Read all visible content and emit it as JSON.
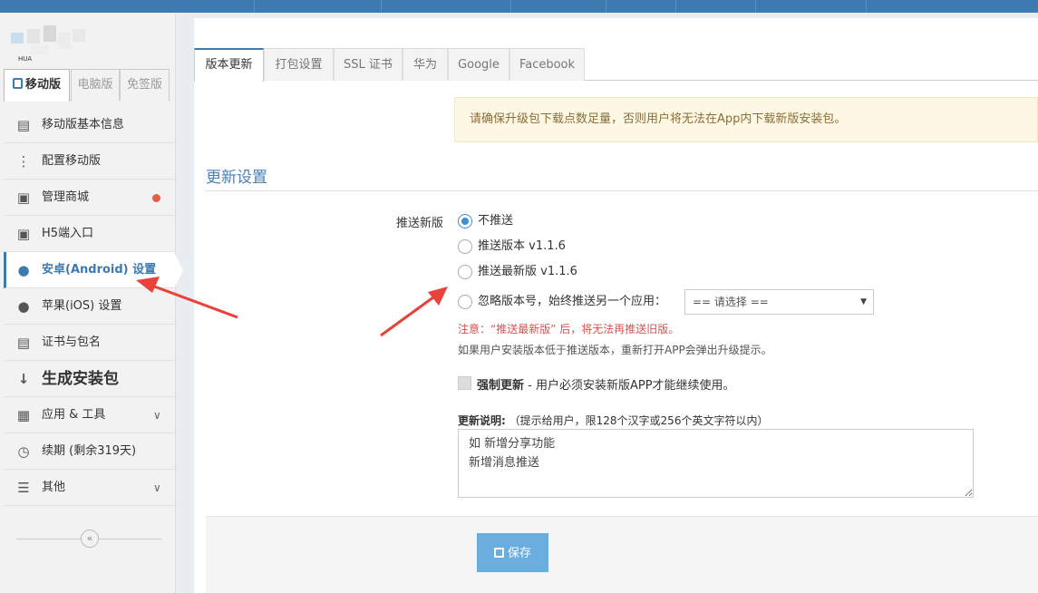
{
  "sidebar": {
    "logo_text": "HUA",
    "tabs": [
      {
        "label": "移动版",
        "active": true
      },
      {
        "label": "电脑版",
        "active": false
      },
      {
        "label": "免签版",
        "active": false
      }
    ],
    "items": [
      {
        "label": "移动版基本信息",
        "icon": "info-list-icon"
      },
      {
        "label": "配置移动版",
        "icon": "sliders-icon"
      },
      {
        "label": "管理商城",
        "icon": "shopping-bag-icon",
        "badge": true
      },
      {
        "label": "H5端入口",
        "icon": "shopping-bag-icon"
      },
      {
        "label": "安卓(Android) 设置",
        "icon": "android-icon",
        "active": true
      },
      {
        "label": "苹果(iOS) 设置",
        "icon": "apple-icon"
      },
      {
        "label": "证书与包名",
        "icon": "certificate-icon"
      },
      {
        "label": "生成安装包",
        "icon": "sort-numeric-icon"
      },
      {
        "label": "应用 & 工具",
        "icon": "grid-icon",
        "expandable": true
      },
      {
        "label": "续期 (剩余319天)",
        "icon": "clock-icon"
      },
      {
        "label": "其他",
        "icon": "menu-icon",
        "expandable": true
      }
    ],
    "collapse_icon": "double-chevron-left-icon"
  },
  "main": {
    "tabs": [
      {
        "label": "版本更新",
        "active": true
      },
      {
        "label": "打包设置"
      },
      {
        "label": "SSL 证书"
      },
      {
        "label": "华为"
      },
      {
        "label": "Google"
      },
      {
        "label": "Facebook"
      }
    ],
    "notice": "请确保升级包下载点数足量，否则用户将无法在App内下载新版安装包。",
    "section_title": "更新设置",
    "push_label": "推送新版",
    "push_options": [
      {
        "label": "不推送",
        "checked": true
      },
      {
        "label": "推送版本 v1.1.6",
        "checked": false
      },
      {
        "label": "推送最新版 v1.1.6",
        "checked": false
      },
      {
        "label": "忽略版本号，始终推送另一个应用：",
        "checked": false
      }
    ],
    "app_select": {
      "selected": "== 请选择 =="
    },
    "warning": "注意：“推送最新版” 后，将无法再推送旧版。",
    "hint": "如果用户安装版本低于推送版本，重新打开APP会弹出升级提示。",
    "force_update": {
      "title": "强制更新",
      "desc": " - 用户必须安装新版APP才能继续使用。",
      "checked": false
    },
    "description": {
      "title": "更新说明:",
      "sub": "（提示给用户，限128个汉字或256个英文字符以内）",
      "value": "如 新增分享功能\n新增消息推送"
    },
    "save_label": "保存"
  },
  "colors": {
    "primary": "#3d7ab0",
    "button": "#6aaee0",
    "warning_text": "#d9534f",
    "notice_bg": "#fcf8e3",
    "badge": "#e0604c",
    "arrow": "#e8423a"
  }
}
